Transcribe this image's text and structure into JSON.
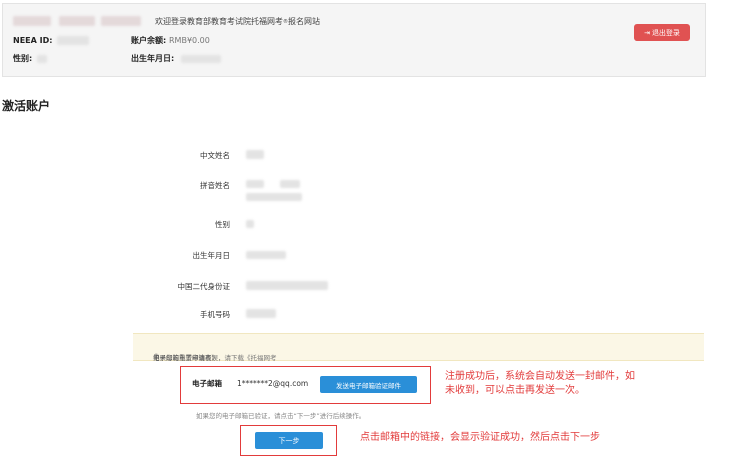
{
  "header": {
    "welcome": "欢迎登录教育部教育考试院托福网考",
    "welcome_sup": "®",
    "welcome_suffix": "报名网站",
    "neea_id_label": "NEEA ID:",
    "gender_label": "性别:",
    "balance_label": "账户余额:",
    "balance_value": "RMB¥0.00",
    "birth_label": "出生年月日:",
    "logout_label": "退出登录"
  },
  "page_title": "激活账户",
  "form": {
    "chinese_name_label": "中文姓名",
    "pinyin_name_label": "拼音姓名",
    "gender_label": "性别",
    "birth_label": "出生年月日",
    "id_card_label": "中国二代身份证",
    "phone_label": "手机号码"
  },
  "notice": {
    "prefix": "如果您的电子邮箱有误，请下载《托福网考",
    "sup": "®",
    "suffix": "电子邮箱重置申请表》"
  },
  "email": {
    "label": "电子邮箱",
    "value": "1*******2@qq.com",
    "send_button": "发送电子邮箱验证邮件",
    "hint": "如果您的电子邮箱已验证，请点击“下一步”进行后续操作。"
  },
  "next_button": "下一步",
  "annotations": {
    "email_line1": "注册成功后，系统会自动发送一封邮件，如",
    "email_line2": "未收到，可以点击再发送一次。",
    "next": "点击邮箱中的链接，会显示验证成功，然后点击下一步"
  },
  "colors": {
    "accent_blue": "#2a8fd8",
    "logout_red": "#e05252",
    "annotation_red": "#e23b3b",
    "notice_bg": "#fbf7e6"
  },
  "icons": {
    "logout": "logout-icon"
  }
}
